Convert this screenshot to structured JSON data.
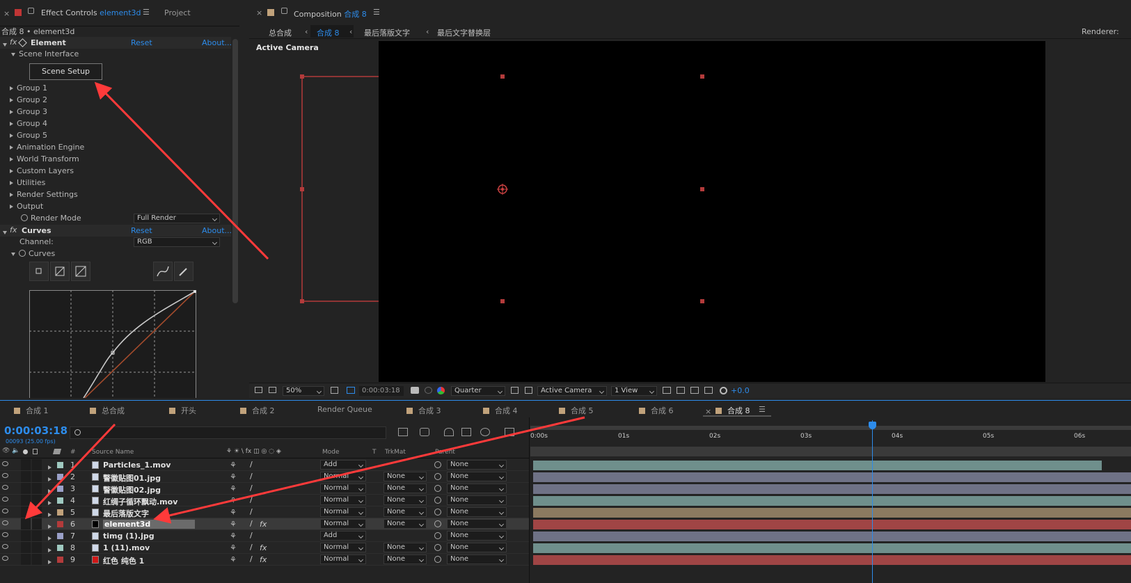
{
  "left_panel": {
    "tab_effect_controls": "Effect Controls",
    "tab_effect_layer": "element3d",
    "tab_project": "Project",
    "breadcrumb": "合成 8 • element3d",
    "element_fx": {
      "name": "Element",
      "reset": "Reset",
      "about": "About...",
      "scene_interface": "Scene Interface",
      "scene_setup_button": "Scene Setup",
      "groups": [
        "Group 1",
        "Group 2",
        "Group 3",
        "Group 4",
        "Group 5",
        "Animation Engine",
        "World Transform",
        "Custom Layers",
        "Utilities",
        "Render Settings",
        "Output"
      ],
      "render_mode_label": "Render Mode",
      "render_mode_value": "Full Render"
    },
    "curves_fx": {
      "name": "Curves",
      "reset": "Reset",
      "about": "About...",
      "channel_label": "Channel:",
      "channel_value": "RGB",
      "curves_label": "Curves"
    }
  },
  "composition": {
    "tab_label": "Composition",
    "tab_name": "合成 8",
    "breadcrumbs": [
      "总合成",
      "合成 8",
      "最后落版文字",
      "最后文字替换层"
    ],
    "renderer_label": "Renderer:",
    "active_camera_label": "Active Camera",
    "footer": {
      "zoom": "50%",
      "timecode": "0:00:03:18",
      "resolution": "Quarter",
      "camera": "Active Camera",
      "views": "1 View",
      "exposure": "+0.0"
    }
  },
  "timeline": {
    "tabs": [
      "合成 1",
      "总合成",
      "开头",
      "合成 2",
      "Render Queue",
      "合成 3",
      "合成 4",
      "合成 5",
      "合成 6",
      "合成 8"
    ],
    "tab_colors": [
      "#c1a27b",
      "#c1a27b",
      "#c1a27b",
      "#c1a27b",
      "",
      "#c1a27b",
      "#c1a27b",
      "#c1a27b",
      "#c1a27b",
      "#c1a27b"
    ],
    "timecode": "0:00:03:18",
    "frames_fps": "00093 (25.00 fps)",
    "columns": {
      "num": "#",
      "source_name": "Source Name",
      "mode": "Mode",
      "t": "T",
      "trkmat": "TrkMat",
      "parent": "Parent"
    },
    "ruler": [
      "0:00s",
      "01s",
      "02s",
      "03s",
      "04s",
      "05s",
      "06s"
    ],
    "layers": [
      {
        "num": "1",
        "name": "Particles_1.mov",
        "mode": "Add",
        "trkmat": "",
        "parent": "None",
        "label_color": "#9fc9c0",
        "bar_color": "#6f8f8c",
        "icon": "movie-icon",
        "fx": false
      },
      {
        "num": "2",
        "name": "警徽贴图01.jpg",
        "mode": "Normal",
        "trkmat": "None",
        "parent": "None",
        "label_color": "#9aa0c8",
        "bar_color": "#6f7286",
        "icon": "image-icon",
        "fx": false
      },
      {
        "num": "3",
        "name": "警徽贴图02.jpg",
        "mode": "Normal",
        "trkmat": "None",
        "parent": "None",
        "label_color": "#9aa0c8",
        "bar_color": "#6f7286",
        "icon": "image-icon",
        "fx": false
      },
      {
        "num": "4",
        "name": "红绸子循环飘动.mov",
        "mode": "Normal",
        "trkmat": "None",
        "parent": "None",
        "label_color": "#9fc9c0",
        "bar_color": "#6f8f8c",
        "icon": "movie-icon",
        "fx": false
      },
      {
        "num": "5",
        "name": "最后落版文字",
        "mode": "Normal",
        "trkmat": "None",
        "parent": "None",
        "label_color": "#c1a27b",
        "bar_color": "#8b7a60",
        "icon": "comp-icon",
        "fx": false
      },
      {
        "num": "6",
        "name": "element3d",
        "mode": "Normal",
        "trkmat": "None",
        "parent": "None",
        "label_color": "#b33b3b",
        "bar_color": "#a04545",
        "icon": "solid-icon",
        "fx": true
      },
      {
        "num": "7",
        "name": "timg (1).jpg",
        "mode": "Add",
        "trkmat": "",
        "parent": "None",
        "label_color": "#9aa0c8",
        "bar_color": "#6f7286",
        "icon": "image-icon",
        "fx": false
      },
      {
        "num": "8",
        "name": "1 (11).mov",
        "mode": "Normal",
        "trkmat": "None",
        "parent": "None",
        "label_color": "#9fc9c0",
        "bar_color": "#6f8f8c",
        "icon": "movie-icon",
        "fx": true
      },
      {
        "num": "9",
        "name": "红色 纯色 1",
        "mode": "Normal",
        "trkmat": "None",
        "parent": "None",
        "label_color": "#b33b3b",
        "bar_color": "#a04545",
        "icon": "solid-red-icon",
        "fx": true
      }
    ]
  }
}
